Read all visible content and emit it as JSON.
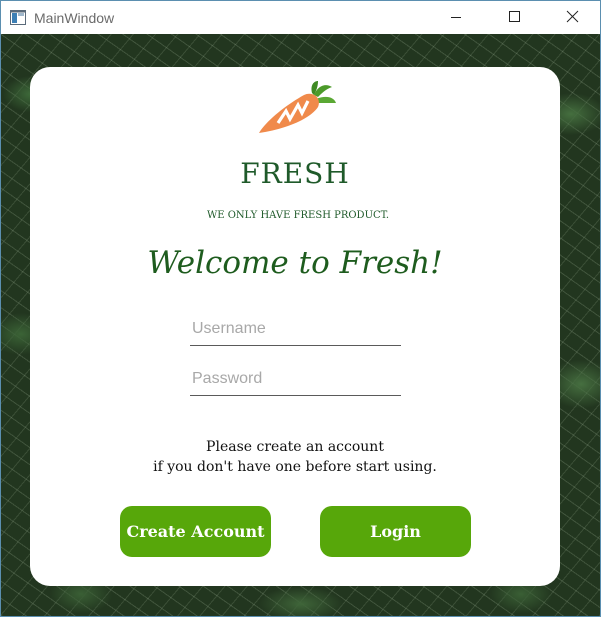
{
  "window": {
    "title": "MainWindow",
    "icons": {
      "app": "app-window-icon",
      "minimize": "minimize-icon",
      "maximize": "maximize-icon",
      "close": "close-icon"
    }
  },
  "colors": {
    "accent_green": "#57a70a",
    "brand_green": "#1f5a2a",
    "welcome_green": "#1e5c1e",
    "carrot_orange": "#f08a4b",
    "leaf_green": "#4c9a2a"
  },
  "card": {
    "logo_icon": "carrot-icon",
    "brand": "FRESH",
    "tagline": "WE ONLY HAVE FRESH PRODUCT.",
    "welcome": "Welcome to Fresh!",
    "username": {
      "placeholder": "Username",
      "value": ""
    },
    "password": {
      "placeholder": "Password",
      "value": ""
    },
    "info_line1": "Please create an account",
    "info_line2": "if you don't have one before start using.",
    "create_button": "Create Account",
    "login_button": "Login"
  }
}
